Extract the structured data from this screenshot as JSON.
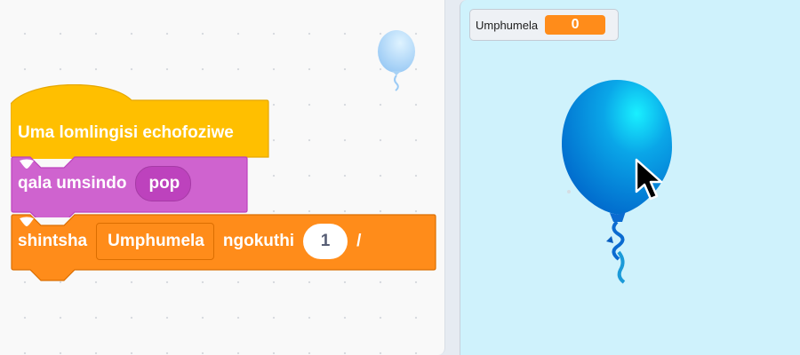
{
  "code_area": {
    "hat_block": {
      "text": "Uma lomlingisi echofoziwe",
      "color": "#ffbf00"
    },
    "sound_block": {
      "text": "qala umsindo",
      "sound_dropdown": "pop",
      "color": "#cf63cf"
    },
    "data_block": {
      "text_change": "shintsha",
      "variable_dropdown": "Umphumela",
      "text_by": "ngokuthi",
      "value_input": "1",
      "trailing_text": "/",
      "color": "#ff8c1a"
    },
    "ghost_sprite_icon": "balloon-icon"
  },
  "stage": {
    "background": "#cff2fc",
    "monitor": {
      "label": "Umphumela",
      "value": "0"
    },
    "sprite_icon": "balloon-icon",
    "cursor_icon": "arrow-cursor-icon"
  }
}
